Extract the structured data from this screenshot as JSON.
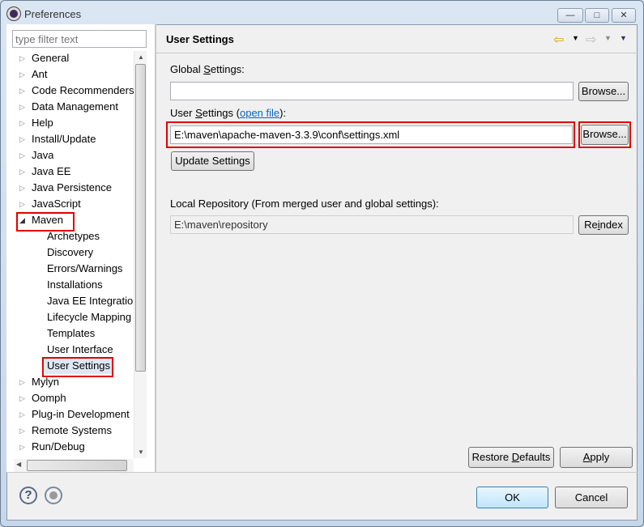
{
  "window": {
    "title": "Preferences",
    "minimize": "—",
    "maximize": "□",
    "close": "✕"
  },
  "filter": {
    "placeholder": "type filter text"
  },
  "tree": {
    "items": [
      {
        "label": "General",
        "level": 0,
        "expanded": false
      },
      {
        "label": "Ant",
        "level": 0,
        "expanded": false
      },
      {
        "label": "Code Recommenders",
        "level": 0,
        "expanded": false
      },
      {
        "label": "Data Management",
        "level": 0,
        "expanded": false
      },
      {
        "label": "Help",
        "level": 0,
        "expanded": false
      },
      {
        "label": "Install/Update",
        "level": 0,
        "expanded": false
      },
      {
        "label": "Java",
        "level": 0,
        "expanded": false
      },
      {
        "label": "Java EE",
        "level": 0,
        "expanded": false
      },
      {
        "label": "Java Persistence",
        "level": 0,
        "expanded": false
      },
      {
        "label": "JavaScript",
        "level": 0,
        "expanded": false
      },
      {
        "label": "Maven",
        "level": 0,
        "expanded": true,
        "highlighted": true
      },
      {
        "label": "Archetypes",
        "level": 1
      },
      {
        "label": "Discovery",
        "level": 1
      },
      {
        "label": "Errors/Warnings",
        "level": 1
      },
      {
        "label": "Installations",
        "level": 1
      },
      {
        "label": "Java EE Integration",
        "level": 1
      },
      {
        "label": "Lifecycle Mapping",
        "level": 1
      },
      {
        "label": "Templates",
        "level": 1
      },
      {
        "label": "User Interface",
        "level": 1
      },
      {
        "label": "User Settings",
        "level": 1,
        "selected": true,
        "highlighted": true
      },
      {
        "label": "Mylyn",
        "level": 0,
        "expanded": false
      },
      {
        "label": "Oomph",
        "level": 0,
        "expanded": false
      },
      {
        "label": "Plug-in Development",
        "level": 0,
        "expanded": false
      },
      {
        "label": "Remote Systems",
        "level": 0,
        "expanded": false
      },
      {
        "label": "Run/Debug",
        "level": 0,
        "expanded": false
      }
    ]
  },
  "page": {
    "title": "User Settings",
    "global_label_pre": "Global ",
    "global_label_u": "S",
    "global_label_post": "ettings:",
    "global_value": "",
    "browse1": "Browse...",
    "user_label_pre": "User ",
    "user_label_u": "S",
    "user_label_mid": "ettings (",
    "open_file": "open file",
    "user_label_post": "):",
    "user_value": "E:\\maven\\apache-maven-3.3.9\\conf\\settings.xml",
    "browse2": "Browse...",
    "update": "Update Settings",
    "local_label": "Local Repository (From merged user and global settings):",
    "local_value": "E:\\maven\\repository",
    "reindex_pre": "Re",
    "reindex_u": "i",
    "reindex_post": "ndex",
    "restore_pre": "Restore ",
    "restore_u": "D",
    "restore_post": "efaults",
    "apply_u": "A",
    "apply_post": "pply"
  },
  "footer": {
    "ok": "OK",
    "cancel": "Cancel"
  },
  "colors": {
    "highlight": "#e00000",
    "link": "#0066cc"
  }
}
